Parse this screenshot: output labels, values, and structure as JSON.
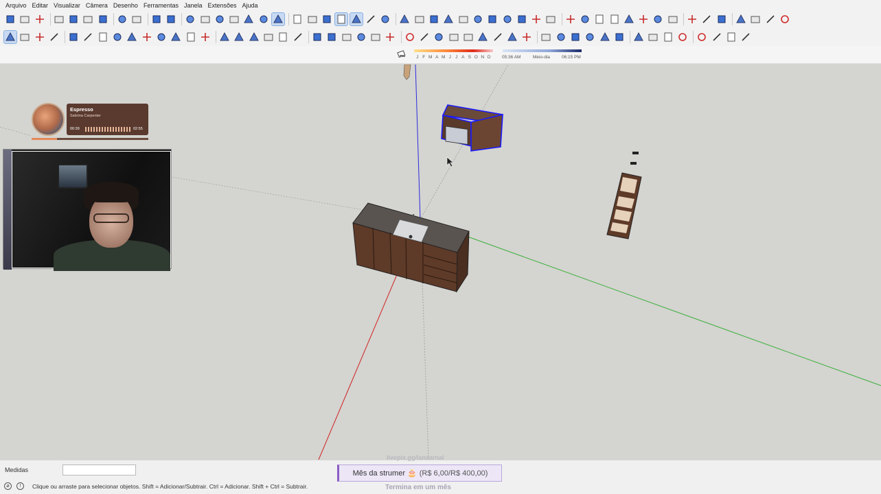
{
  "menu": [
    "Arquivo",
    "Editar",
    "Visualizar",
    "Câmera",
    "Desenho",
    "Ferramentas",
    "Janela",
    "Extensões",
    "Ajuda"
  ],
  "toolbar1_icons": [
    "new-file-icon",
    "open-file-icon",
    "save-icon",
    "cut-icon",
    "copy-icon",
    "paste-icon",
    "delete-icon",
    "undo-icon",
    "redo-icon",
    "print-icon",
    "model-info-icon",
    "iso-view-icon",
    "top-view-icon",
    "front-view-icon",
    "right-view-icon",
    "back-view-icon",
    "left-view-icon",
    "bottom-view-icon",
    "orbit-icon",
    "pan-icon",
    "zoom-icon",
    "zoom-extents-icon",
    "xray-icon",
    "back-edges-icon",
    "wireframe-icon",
    "hidden-line-icon",
    "shaded-icon",
    "shaded-textures-icon",
    "monochrome-icon",
    "section-plane-icon",
    "section-display-icon",
    "section-cut-icon",
    "geolocate-icon",
    "photo-texture-icon",
    "3d-warehouse-icon",
    "extension-warehouse-icon",
    "layout-icon",
    "components-icon",
    "materials-icon",
    "styles-icon",
    "scenes-icon",
    "shadows-icon",
    "fog-icon",
    "match-photo-icon",
    "soften-icon",
    "outliner-icon",
    "layers-icon",
    "extension-manager-icon",
    "info-icon",
    "cart-icon",
    "account-icon"
  ],
  "toolbar2_icons": [
    "select-icon",
    "component-icon",
    "paint-bucket-icon",
    "eraser-icon",
    "line-icon",
    "freehand-icon",
    "rectangle-icon",
    "rotated-rect-icon",
    "circle-icon",
    "polygon-icon",
    "arc-icon",
    "two-point-arc-icon",
    "three-point-arc-icon",
    "pie-icon",
    "move-icon",
    "push-pull-icon",
    "rotate-icon",
    "follow-me-icon",
    "scale-icon",
    "offset-icon",
    "tape-measure-icon",
    "dimension-icon",
    "protractor-icon",
    "text-icon",
    "axes-icon",
    "3d-text-icon",
    "sandbox-icon",
    "smoove-icon",
    "stamp-icon",
    "drape-icon",
    "add-detail-icon",
    "flip-edge-icon",
    "position-camera-icon",
    "look-around-icon",
    "walk-icon",
    "zoom-window-icon",
    "previous-view-icon",
    "next-view-icon",
    "section-icon",
    "dynamic-component-icon",
    "interact-icon",
    "solid-union-icon",
    "solid-subtract-icon",
    "solid-trim-icon",
    "intersect-icon",
    "mirror-icon",
    "curve-icon",
    "dimension-tool-icon",
    "marquee-icon"
  ],
  "shadows": {
    "months": [
      "J",
      "F",
      "M",
      "A",
      "M",
      "J",
      "J",
      "A",
      "S",
      "O",
      "N",
      "D"
    ],
    "time_start": "05:36 AM",
    "midday": "Meio-dia",
    "time_end": "06:15 PM"
  },
  "music": {
    "title": "Espresso",
    "artist": "Sabrina Carpenter",
    "elapsed": "00:39",
    "duration": "02:55",
    "progress": 0.22
  },
  "status": {
    "measures_label": "Medidas",
    "measures_value": "",
    "hint": "Clique ou arraste para selecionar objetos. Shift = Adicionar/Subtrair. Ctrl = Adicionar. Shift + Ctrl = Subtrair."
  },
  "goal": {
    "url": "livepix.gg/lanaarnal",
    "label": "Mês da strumer 🎂",
    "amount": "(R$ 6,00/R$ 400,00)",
    "ends": "Termina em um mês"
  }
}
